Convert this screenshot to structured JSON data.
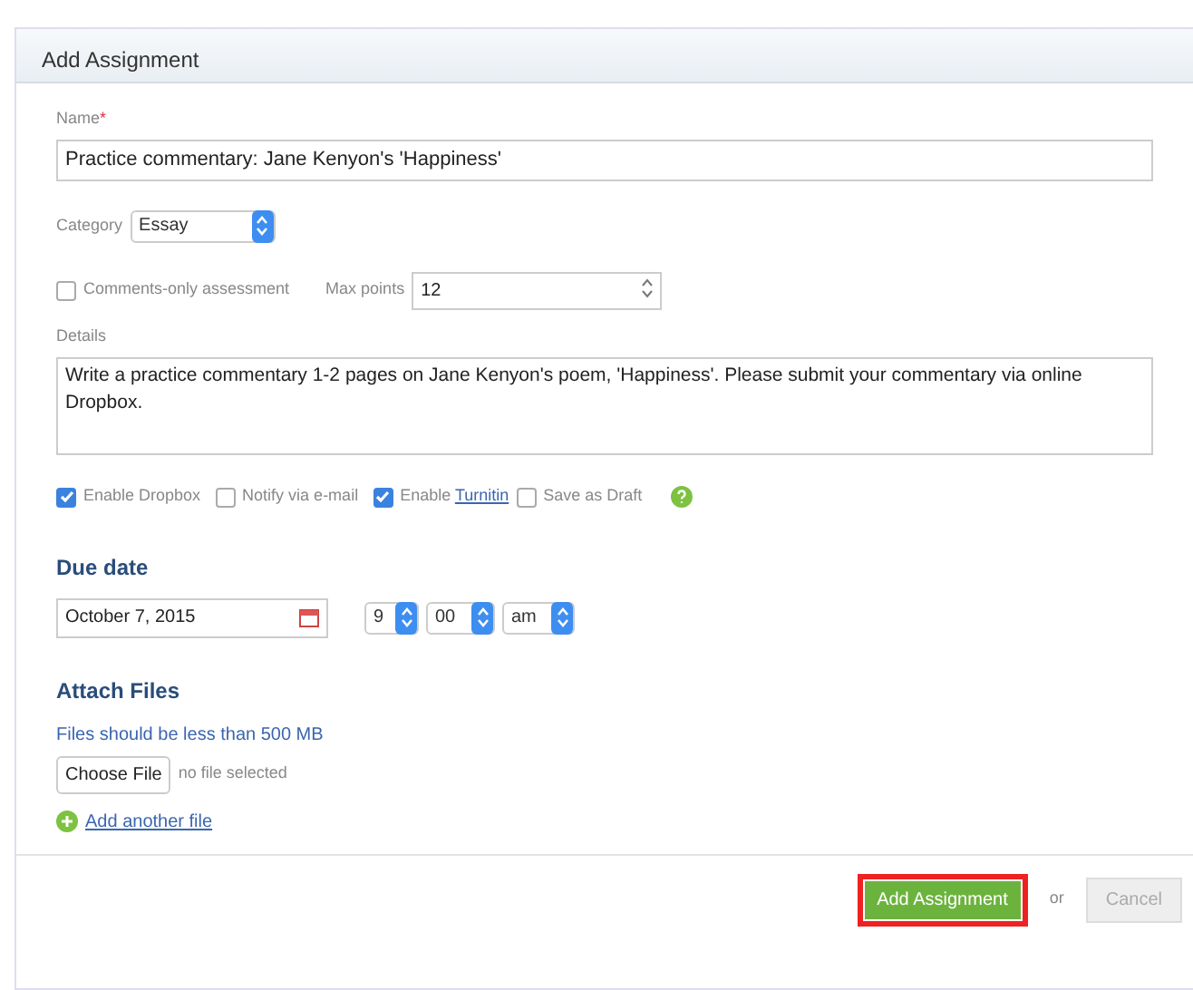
{
  "dialog": {
    "title": "Add Assignment"
  },
  "name": {
    "label": "Name",
    "required_mark": "*",
    "value": "Practice commentary: Jane Kenyon's 'Happiness'"
  },
  "category": {
    "label": "Category",
    "value": "Essay"
  },
  "comments_only": {
    "label": "Comments-only assessment",
    "checked": false
  },
  "max_points": {
    "label": "Max points",
    "value": "12"
  },
  "details": {
    "label": "Details",
    "value": "Write a practice commentary 1-2 pages on Jane Kenyon's poem, 'Happiness'. Please submit your commentary via online Dropbox."
  },
  "options": [
    {
      "label": "Enable Dropbox",
      "checked": true
    },
    {
      "label": "Notify via e-mail",
      "checked": false
    },
    {
      "label": "Enable",
      "link": "Turnitin",
      "checked": true
    },
    {
      "label": "Save as Draft",
      "checked": false
    }
  ],
  "due_date": {
    "heading": "Due date",
    "date": "October 7, 2015",
    "hour": "9",
    "minute": "00",
    "ampm": "am"
  },
  "attach": {
    "heading": "Attach Files",
    "note": "Files should be less than 500 MB",
    "choose_button": "Choose File",
    "file_status": "no file selected",
    "add_link": "Add another file"
  },
  "footer": {
    "submit": "Add Assignment",
    "submit_highlighted": true,
    "separator": "or",
    "cancel": "Cancel",
    "cancel_disabled": true
  }
}
